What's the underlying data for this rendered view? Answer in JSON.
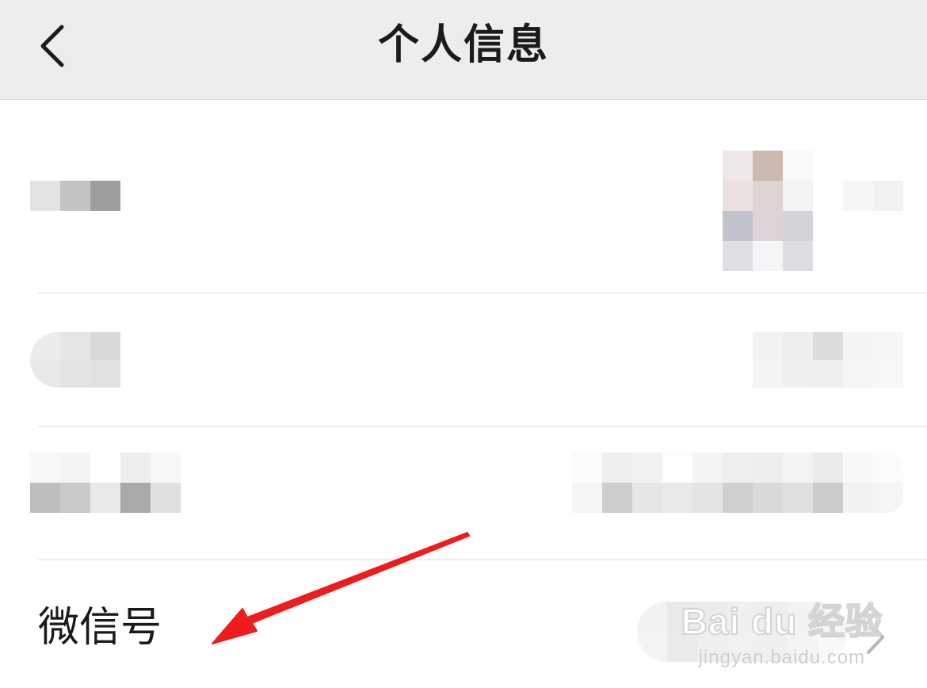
{
  "nav": {
    "title": "个人信息",
    "back_icon": "chevron-left-icon"
  },
  "rows": [
    {
      "id": "avatar",
      "label": "",
      "value": "",
      "blurred": true
    },
    {
      "id": "name",
      "label": "",
      "value": "",
      "blurred": true
    },
    {
      "id": "pat",
      "label": "",
      "value": "",
      "blurred": true
    },
    {
      "id": "wechat-id",
      "label": "微信号",
      "value": "",
      "blurred_value": true,
      "chevron_icon": "chevron-right-icon"
    }
  ],
  "annotation": {
    "type": "red-arrow",
    "color": "#ee1c1c"
  },
  "watermark": {
    "logo": "Bai du 经验",
    "url": "jingyan.baidu.com"
  },
  "colors": {
    "nav_bg": "#ededed",
    "page_bg": "#ffffff",
    "divider": "#eeeeee",
    "text": "#1a1a1a",
    "arrow": "#ee1c1c"
  }
}
